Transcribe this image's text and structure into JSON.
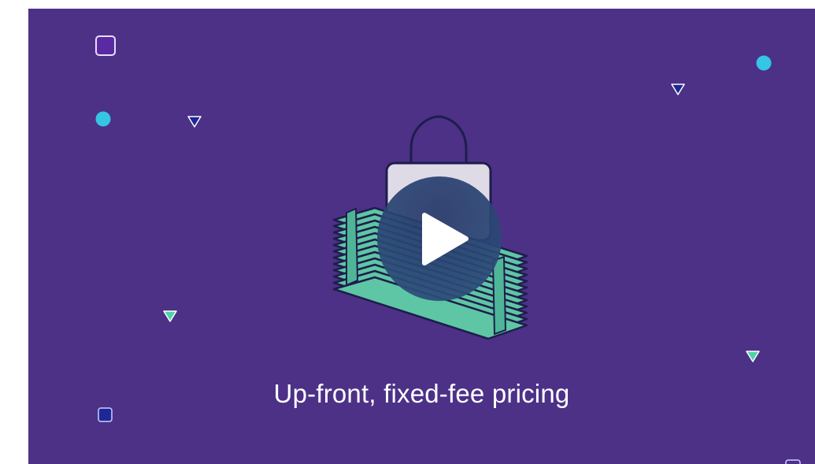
{
  "video": {
    "caption": "Up-front, fixed-fee pricing"
  },
  "colors": {
    "background": "#4c3187",
    "money_fill": "#5ec6a4",
    "outline": "#1e1d4c",
    "lock_body": "#dedbe6",
    "accent_cyan": "#34c6e4",
    "accent_teal": "#4fd1a9",
    "accent_navy": "#1f2696",
    "play_overlay": "#2b4a78"
  },
  "icons": {
    "play": "play-icon",
    "illustration": "padlock-on-cash-stack"
  }
}
